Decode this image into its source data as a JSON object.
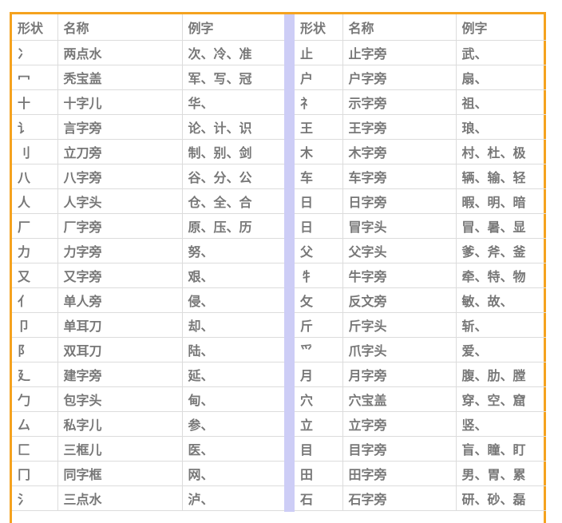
{
  "headers": {
    "shape": "形状",
    "name": "名称",
    "examples": "例字"
  },
  "left_rows": [
    {
      "shape": "冫",
      "name": "两点水",
      "examples": "次、冷、准"
    },
    {
      "shape": "冖",
      "name": "秃宝盖",
      "examples": "军、写、冠"
    },
    {
      "shape": "十",
      "name": "十字儿",
      "examples": "华、"
    },
    {
      "shape": "讠",
      "name": "言字旁",
      "examples": "论、计、识"
    },
    {
      "shape": "刂",
      "name": "立刀旁",
      "examples": "制、别、剑"
    },
    {
      "shape": "八",
      "name": "八字旁",
      "examples": "谷、分、公"
    },
    {
      "shape": "人",
      "name": "人字头",
      "examples": "仓、全、合"
    },
    {
      "shape": "厂",
      "name": "厂字旁",
      "examples": "原、压、历"
    },
    {
      "shape": "力",
      "name": "力字旁",
      "examples": "努、"
    },
    {
      "shape": "又",
      "name": "又字旁",
      "examples": "艰、"
    },
    {
      "shape": "亻",
      "name": "单人旁",
      "examples": "侵、"
    },
    {
      "shape": "卩",
      "name": "单耳刀",
      "examples": "却、"
    },
    {
      "shape": "阝",
      "name": "双耳刀",
      "examples": "陆、"
    },
    {
      "shape": "廴",
      "name": "建字旁",
      "examples": "延、"
    },
    {
      "shape": "勹",
      "name": "包字头",
      "examples": "甸、"
    },
    {
      "shape": "厶",
      "name": "私字儿",
      "examples": "参、"
    },
    {
      "shape": "匚",
      "name": "三框儿",
      "examples": "医、"
    },
    {
      "shape": "冂",
      "name": "同字框",
      "examples": "网、"
    },
    {
      "shape": "氵",
      "name": "三点水",
      "examples": "泸、"
    }
  ],
  "right_rows": [
    {
      "shape": "止",
      "name": "止字旁",
      "examples": "武、"
    },
    {
      "shape": "户",
      "name": "户字旁",
      "examples": "扇、"
    },
    {
      "shape": "礻",
      "name": "示字旁",
      "examples": "祖、"
    },
    {
      "shape": "王",
      "name": "王字旁",
      "examples": "琅、"
    },
    {
      "shape": "木",
      "name": "木字旁",
      "examples": "村、杜、极"
    },
    {
      "shape": "车",
      "name": "车字旁",
      "examples": "辆、输、轻"
    },
    {
      "shape": "日",
      "name": "日字旁",
      "examples": "暇、明、暗"
    },
    {
      "shape": "日",
      "name": "冒字头",
      "examples": "冒、暑、显"
    },
    {
      "shape": "父",
      "name": "父字头",
      "examples": "爹、斧、釜"
    },
    {
      "shape": "牜",
      "name": "牛字旁",
      "examples": "牵、特、物"
    },
    {
      "shape": "攵",
      "name": "反文旁",
      "examples": "敏、故、"
    },
    {
      "shape": "斤",
      "name": "斤字头",
      "examples": "斩、"
    },
    {
      "shape": "爫",
      "name": "爪字头",
      "examples": "爱、"
    },
    {
      "shape": "月",
      "name": "月字旁",
      "examples": "腹、肋、膛"
    },
    {
      "shape": "穴",
      "name": "穴宝盖",
      "examples": "穿、空、窟"
    },
    {
      "shape": "立",
      "name": "立字旁",
      "examples": "竖、"
    },
    {
      "shape": "目",
      "name": "目字旁",
      "examples": "盲、瞳、盯"
    },
    {
      "shape": "田",
      "name": "田字旁",
      "examples": "男、胃、累"
    },
    {
      "shape": "石",
      "name": "石字旁",
      "examples": "研、砂、磊"
    }
  ],
  "colors": {
    "border": "#f5a21e",
    "separator": "#cdcdf6",
    "text": "#777777"
  }
}
